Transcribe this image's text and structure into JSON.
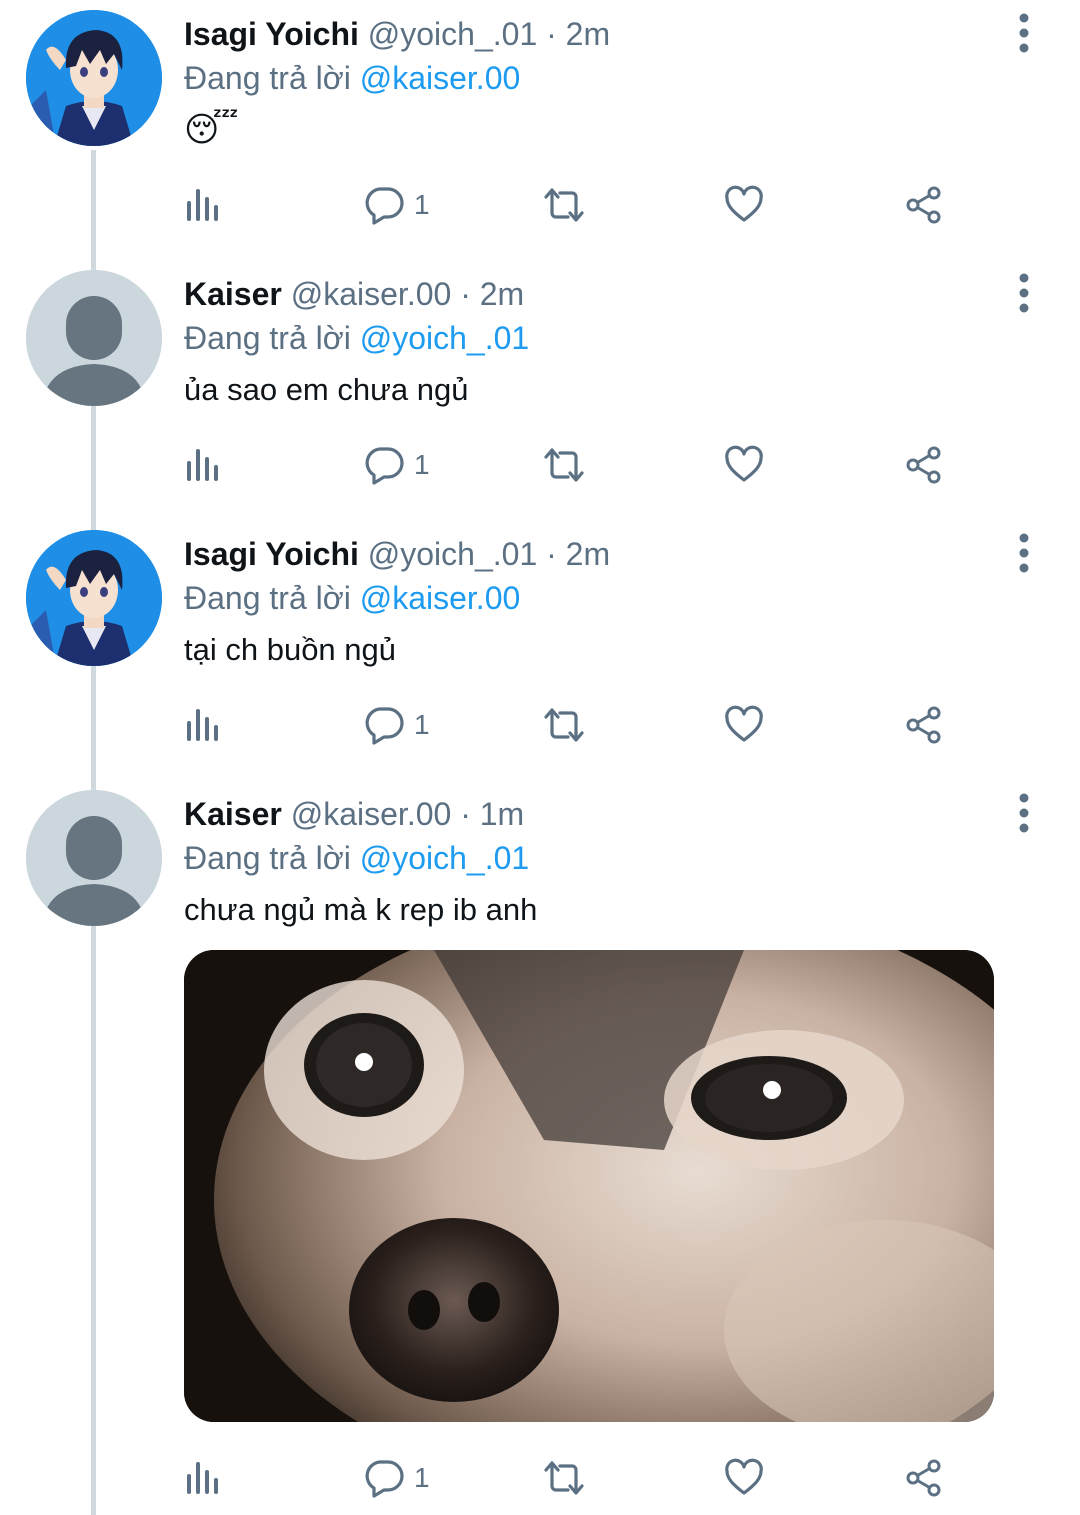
{
  "tweets": [
    {
      "name": "Isagi Yoichi",
      "handle": "@yoich_.01",
      "dot": "·",
      "time": "2m",
      "reply_prefix": "Đang trả lời ",
      "reply_to": "@kaiser.00",
      "text": "😴",
      "reply_count": "1",
      "avatar": "anime-boy-avatar"
    },
    {
      "name": "Kaiser",
      "handle": "@kaiser.00",
      "dot": "·",
      "time": "2m",
      "reply_prefix": "Đang trả lời ",
      "reply_to": "@yoich_.01",
      "text": "ủa sao em chưa ngủ",
      "reply_count": "1",
      "avatar": "default-avatar"
    },
    {
      "name": "Isagi Yoichi",
      "handle": "@yoich_.01",
      "dot": "·",
      "time": "2m",
      "reply_prefix": "Đang trả lời ",
      "reply_to": "@kaiser.00",
      "text": "tại ch buồn ngủ",
      "reply_count": "1",
      "avatar": "anime-boy-avatar"
    },
    {
      "name": "Kaiser",
      "handle": "@kaiser.00",
      "dot": "·",
      "time": "1m",
      "reply_prefix": "Đang trả lời ",
      "reply_to": "@yoich_.01",
      "text": "chưa ngủ mà k rep ib anh",
      "reply_count": "1",
      "avatar": "default-avatar",
      "media": "sad-chihuahua-photo"
    }
  ],
  "colors": {
    "text": "#0f1419",
    "secondary": "#5b7083",
    "mention": "#1d9bf0",
    "thread_line": "#cfd9de",
    "default_avatar_bg": "#ccd6dd"
  },
  "icons": [
    "views-icon",
    "reply-icon",
    "retweet-icon",
    "like-icon",
    "share-icon",
    "more-icon"
  ]
}
